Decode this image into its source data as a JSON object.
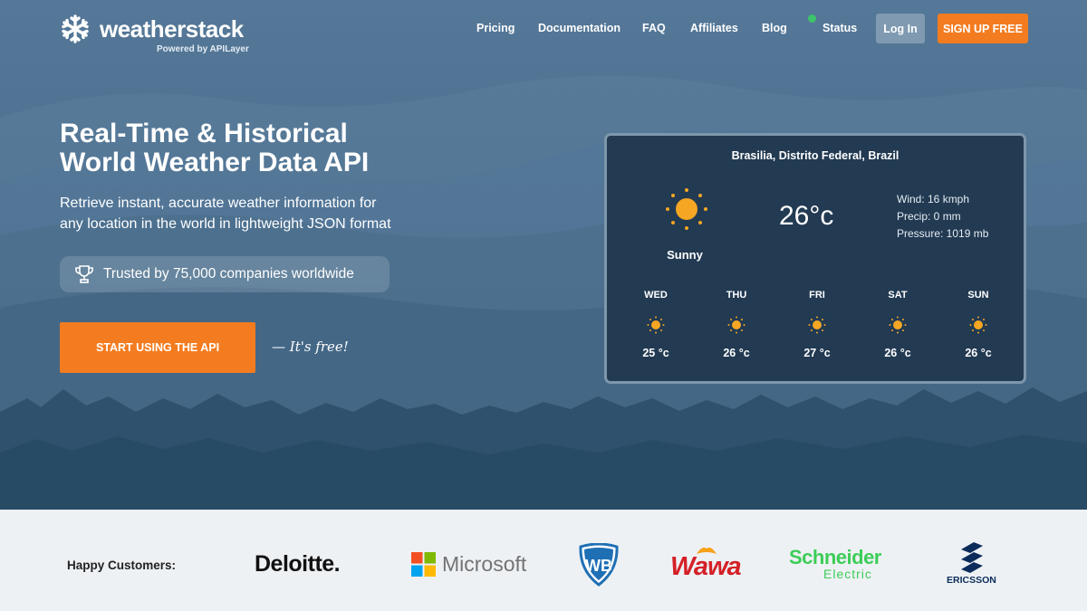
{
  "brand": {
    "name": "weatherstack",
    "powered_by": "Powered by APILayer"
  },
  "nav": {
    "items": [
      "Pricing",
      "Documentation",
      "FAQ",
      "Affiliates",
      "Blog",
      "Status"
    ],
    "login": "Log In",
    "signup": "SIGN UP FREE"
  },
  "hero": {
    "title_line1": "Real-Time & Historical",
    "title_line2": "World Weather Data API",
    "subtitle_line1": "Retrieve instant, accurate weather information for",
    "subtitle_line2": "any location in the world in lightweight JSON format",
    "trusted": "Trusted by 75,000 companies worldwide",
    "cta": "START USING THE API",
    "free_note": "— It's free!"
  },
  "widget": {
    "location": "Brasilia, Distrito Federal, Brazil",
    "condition": "Sunny",
    "temperature": "26°c",
    "wind": "Wind: 16 kmph",
    "precip": "Precip: 0 mm",
    "pressure": "Pressure: 1019 mb",
    "forecast": [
      {
        "day": "WED",
        "temp": "25 °c"
      },
      {
        "day": "THU",
        "temp": "26 °c"
      },
      {
        "day": "FRI",
        "temp": "27 °c"
      },
      {
        "day": "SAT",
        "temp": "26 °c"
      },
      {
        "day": "SUN",
        "temp": "26 °c"
      }
    ]
  },
  "customers": {
    "label": "Happy Customers:",
    "logos": [
      "Deloitte.",
      "Microsoft",
      "WB",
      "Wawa",
      "Schneider",
      "Electric",
      "ERICSSON"
    ]
  },
  "colors": {
    "accent": "#f47c20",
    "status_green": "#3dc36a",
    "widget_bg": "#223a52",
    "sun": "#f5a623"
  }
}
